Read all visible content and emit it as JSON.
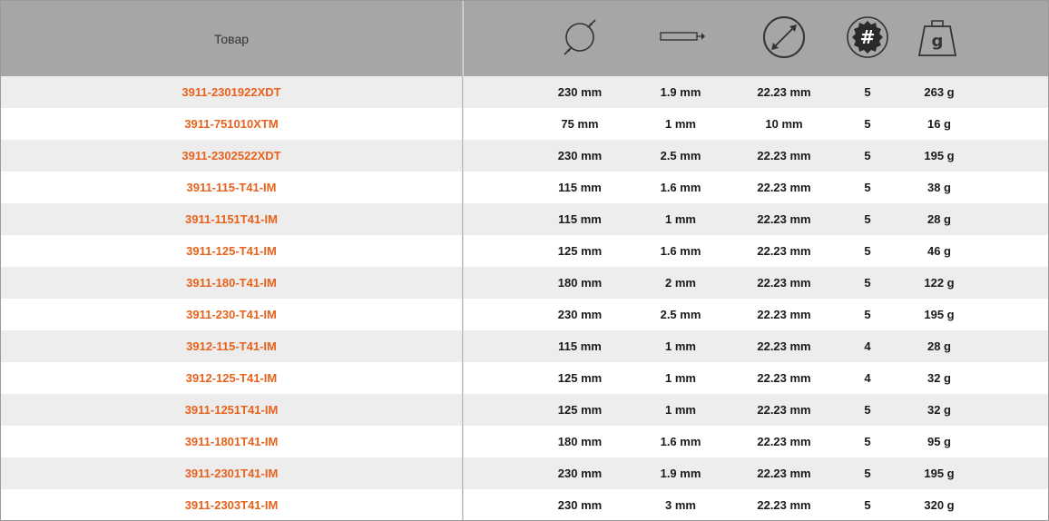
{
  "header": {
    "product_label": "Товар",
    "icons": [
      "diameter-icon",
      "thickness-icon",
      "bore-icon",
      "quantity-icon",
      "weight-icon"
    ],
    "weight_glyph": "g",
    "quantity_glyph": "#"
  },
  "colors": {
    "header_bg": "#a6a6a6",
    "sku_color": "#e8621c",
    "row_alt_bg": "#ededed"
  },
  "rows": [
    {
      "sku": "3911-2301922XDT",
      "diameter": "230 mm",
      "thickness": "1.9 mm",
      "bore": "22.23 mm",
      "qty": "5",
      "weight": "263 g"
    },
    {
      "sku": "3911-751010XTM",
      "diameter": "75 mm",
      "thickness": "1 mm",
      "bore": "10 mm",
      "qty": "5",
      "weight": "16 g"
    },
    {
      "sku": "3911-2302522XDT",
      "diameter": "230 mm",
      "thickness": "2.5 mm",
      "bore": "22.23 mm",
      "qty": "5",
      "weight": "195 g"
    },
    {
      "sku": "3911-115-T41-IM",
      "diameter": "115 mm",
      "thickness": "1.6 mm",
      "bore": "22.23 mm",
      "qty": "5",
      "weight": "38 g"
    },
    {
      "sku": "3911-1151T41-IM",
      "diameter": "115 mm",
      "thickness": "1 mm",
      "bore": "22.23 mm",
      "qty": "5",
      "weight": "28 g"
    },
    {
      "sku": "3911-125-T41-IM",
      "diameter": "125 mm",
      "thickness": "1.6 mm",
      "bore": "22.23 mm",
      "qty": "5",
      "weight": "46 g"
    },
    {
      "sku": "3911-180-T41-IM",
      "diameter": "180 mm",
      "thickness": "2 mm",
      "bore": "22.23 mm",
      "qty": "5",
      "weight": "122 g"
    },
    {
      "sku": "3911-230-T41-IM",
      "diameter": "230 mm",
      "thickness": "2.5 mm",
      "bore": "22.23 mm",
      "qty": "5",
      "weight": "195 g"
    },
    {
      "sku": "3912-115-T41-IM",
      "diameter": "115 mm",
      "thickness": "1 mm",
      "bore": "22.23 mm",
      "qty": "4",
      "weight": "28 g"
    },
    {
      "sku": "3912-125-T41-IM",
      "diameter": "125 mm",
      "thickness": "1 mm",
      "bore": "22.23 mm",
      "qty": "4",
      "weight": "32 g"
    },
    {
      "sku": "3911-1251T41-IM",
      "diameter": "125 mm",
      "thickness": "1 mm",
      "bore": "22.23 mm",
      "qty": "5",
      "weight": "32 g"
    },
    {
      "sku": "3911-1801T41-IM",
      "diameter": "180 mm",
      "thickness": "1.6 mm",
      "bore": "22.23 mm",
      "qty": "5",
      "weight": "95 g"
    },
    {
      "sku": "3911-2301T41-IM",
      "diameter": "230 mm",
      "thickness": "1.9 mm",
      "bore": "22.23 mm",
      "qty": "5",
      "weight": "195 g"
    },
    {
      "sku": "3911-2303T41-IM",
      "diameter": "230 mm",
      "thickness": "3 mm",
      "bore": "22.23 mm",
      "qty": "5",
      "weight": "320 g"
    }
  ]
}
